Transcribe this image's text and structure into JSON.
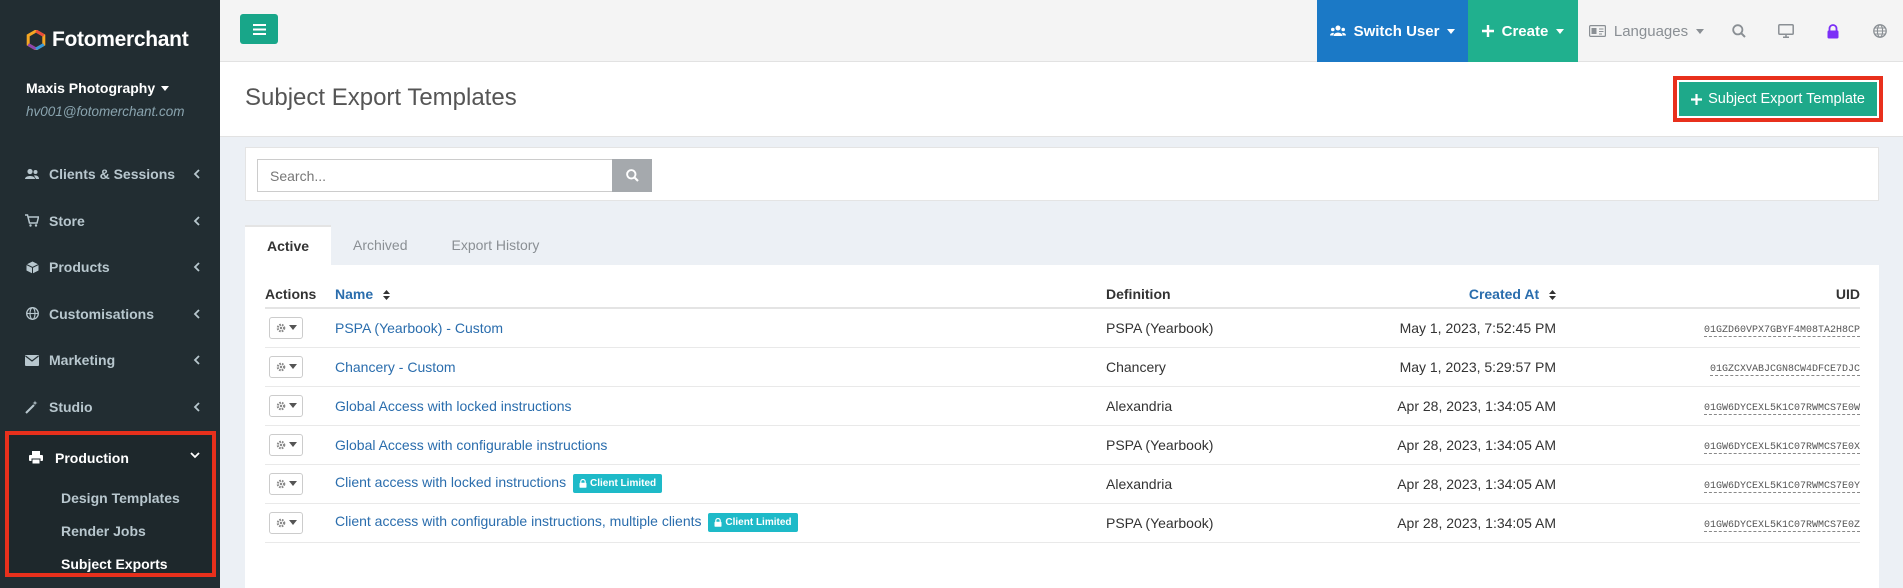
{
  "brand": {
    "name": "Fotomerchant"
  },
  "account": {
    "name": "Maxis Photography",
    "email": "hv001@fotomerchant.com"
  },
  "sidebar": {
    "items": [
      {
        "label": "Clients & Sessions",
        "icon": "users-icon"
      },
      {
        "label": "Store",
        "icon": "cart-icon"
      },
      {
        "label": "Products",
        "icon": "cube-icon"
      },
      {
        "label": "Customisations",
        "icon": "globe-icon"
      },
      {
        "label": "Marketing",
        "icon": "envelope-icon"
      },
      {
        "label": "Studio",
        "icon": "magic-icon"
      }
    ],
    "production": {
      "label": "Production",
      "sub_items": [
        {
          "label": "Design Templates"
        },
        {
          "label": "Render Jobs"
        },
        {
          "label": "Subject Exports",
          "active": true
        }
      ]
    }
  },
  "topbar": {
    "switch_user": "Switch User",
    "create": "Create",
    "languages": "Languages"
  },
  "page": {
    "title": "Subject Export Templates",
    "add_button": "Subject Export Template"
  },
  "search": {
    "placeholder": "Search..."
  },
  "tabs": [
    {
      "label": "Active",
      "active": true
    },
    {
      "label": "Archived"
    },
    {
      "label": "Export History"
    }
  ],
  "table": {
    "headers": {
      "actions": "Actions",
      "name": "Name",
      "definition": "Definition",
      "created_at": "Created At",
      "uid": "UID"
    },
    "rows": [
      {
        "name": "PSPA (Yearbook) - Custom",
        "badge": "",
        "definition": "PSPA (Yearbook)",
        "created_at": "May 1, 2023, 7:52:45 PM",
        "uid": "01GZD60VPX7GBYF4M08TA2H8CP"
      },
      {
        "name": "Chancery - Custom",
        "badge": "",
        "definition": "Chancery",
        "created_at": "May 1, 2023, 5:29:57 PM",
        "uid": "01GZCXVABJCGN8CW4DFCE7DJC"
      },
      {
        "name": "Global Access with locked instructions",
        "badge": "",
        "definition": "Alexandria",
        "created_at": "Apr 28, 2023, 1:34:05 AM",
        "uid": "01GW6DYCEXL5K1C07RWMCS7E0W"
      },
      {
        "name": "Global Access with configurable instructions",
        "badge": "",
        "definition": "PSPA (Yearbook)",
        "created_at": "Apr 28, 2023, 1:34:05 AM",
        "uid": "01GW6DYCEXL5K1C07RWMCS7E0X"
      },
      {
        "name": "Client access with locked instructions",
        "badge": "Client Limited",
        "definition": "Alexandria",
        "created_at": "Apr 28, 2023, 1:34:05 AM",
        "uid": "01GW6DYCEXL5K1C07RWMCS7E0Y"
      },
      {
        "name": "Client access with configurable instructions, multiple clients",
        "badge": "Client Limited",
        "definition": "PSPA (Yearbook)",
        "created_at": "Apr 28, 2023, 1:34:05 AM",
        "uid": "01GW6DYCEXL5K1C07RWMCS7E0Z"
      }
    ]
  },
  "colors": {
    "sidebar_bg": "#222d32",
    "accent_green": "#1ea98a",
    "switch_blue": "#1b79c6",
    "link_blue": "#2a6dad",
    "highlight_red": "#e8301c",
    "badge_teal": "#1ebac8"
  }
}
